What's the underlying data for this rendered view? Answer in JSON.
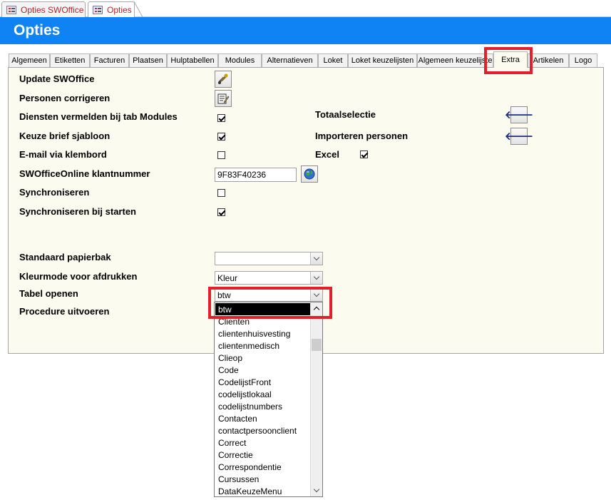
{
  "doc_tabs": [
    {
      "label": "Opties SWOffice"
    },
    {
      "label": "Opties"
    }
  ],
  "header": {
    "title": "Opties"
  },
  "tabs": [
    {
      "label": "Algemeen"
    },
    {
      "label": "Etiketten"
    },
    {
      "label": "Facturen"
    },
    {
      "label": "Plaatsen"
    },
    {
      "label": "Hulptabellen"
    },
    {
      "label": "Modules"
    },
    {
      "label": "Alternatieven"
    },
    {
      "label": "Loket"
    },
    {
      "label": "Loket keuzelijsten"
    },
    {
      "label": "Algemeen keuzelijste"
    },
    {
      "label": "Extra"
    },
    {
      "label": "Artikelen"
    },
    {
      "label": "Logo"
    }
  ],
  "active_tab": "Extra",
  "form": {
    "update_label": "Update SWOffice",
    "personen_label": "Personen corrigeren",
    "diensten_label": "Diensten vermelden bij tab Modules",
    "diensten_checked": true,
    "keuze_label": "Keuze brief sjabloon",
    "keuze_checked": true,
    "email_label": "E-mail via klembord",
    "email_checked": false,
    "klantnummer_label": "SWOfficeOnline klantnummer",
    "klantnummer_value": "9F83F40236",
    "sync_label": "Synchroniseren",
    "sync_checked": false,
    "sync_start_label": "Synchroniseren bij starten",
    "sync_start_checked": true,
    "totaalselectie_label": "Totaalselectie",
    "importeren_label": "Importeren personen",
    "excel_label": "Excel",
    "excel_checked": true,
    "papierbak_label": "Standaard papierbak",
    "papierbak_value": "",
    "kleurmode_label": "Kleurmode voor afdrukken",
    "kleurmode_value": "Kleur",
    "tabel_label": "Tabel openen",
    "tabel_value": "btw",
    "procedure_label": "Procedure uitvoeren"
  },
  "dropdown": {
    "items": [
      "btw",
      "Clienten",
      "clientenhuisvesting",
      "clientenmedisch",
      "Clieop",
      "Code",
      "CodelijstFront",
      "codelijstlokaal",
      "codelijstnumbers",
      "Contacten",
      "contactpersoonclient",
      "Correct",
      "Correctie",
      "Correspondentie",
      "Cursussen",
      "DataKeuzeMenu"
    ],
    "selected_index": 0
  },
  "colors": {
    "header": "#0f83f3",
    "highlight": "#e3202a",
    "panel": "#fbfbf0",
    "doc_tab_text": "#b3262b"
  },
  "icons": {
    "update": "tools-icon",
    "personen": "edit-form-icon",
    "klantnummer": "globe-icon",
    "totaalselectie": "arrow-left-icon",
    "importeren": "arrow-left-icon"
  }
}
